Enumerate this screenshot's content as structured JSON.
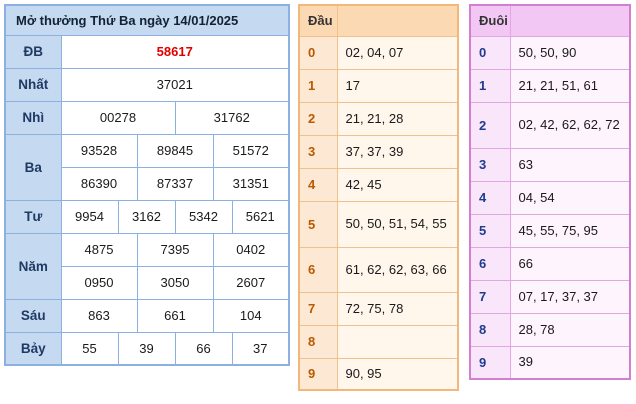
{
  "title": "Mở thưởng Thứ Ba ngày 14/01/2025",
  "results": {
    "db": {
      "label": "ĐB",
      "values": [
        "58617"
      ]
    },
    "nhat": {
      "label": "Nhất",
      "values": [
        "37021"
      ]
    },
    "nhi": {
      "label": "Nhì",
      "values": [
        "00278",
        "31762"
      ]
    },
    "ba": {
      "label": "Ba",
      "values": [
        "93528",
        "89845",
        "51572",
        "86390",
        "87337",
        "31351"
      ]
    },
    "tu": {
      "label": "Tư",
      "values": [
        "9954",
        "3162",
        "5342",
        "5621"
      ]
    },
    "nam": {
      "label": "Năm",
      "values": [
        "4875",
        "7395",
        "0402",
        "0950",
        "3050",
        "2607"
      ]
    },
    "sau": {
      "label": "Sáu",
      "values": [
        "863",
        "661",
        "104"
      ]
    },
    "bay": {
      "label": "Bảy",
      "values": [
        "55",
        "39",
        "66",
        "37"
      ]
    }
  },
  "dau": {
    "header": "Đầu",
    "rows": [
      {
        "key": "0",
        "value": "02, 04, 07"
      },
      {
        "key": "1",
        "value": "17"
      },
      {
        "key": "2",
        "value": "21, 21, 28"
      },
      {
        "key": "3",
        "value": "37, 37, 39"
      },
      {
        "key": "4",
        "value": "42, 45"
      },
      {
        "key": "5",
        "value": "50, 50, 51, 54, 55"
      },
      {
        "key": "6",
        "value": "61, 62, 62, 63, 66"
      },
      {
        "key": "7",
        "value": "72, 75, 78"
      },
      {
        "key": "8",
        "value": ""
      },
      {
        "key": "9",
        "value": "90, 95"
      }
    ]
  },
  "duoi": {
    "header": "Đuôi",
    "rows": [
      {
        "key": "0",
        "value": "50, 50, 90"
      },
      {
        "key": "1",
        "value": "21, 21, 51, 61"
      },
      {
        "key": "2",
        "value": "02, 42, 62, 62, 72"
      },
      {
        "key": "3",
        "value": "63"
      },
      {
        "key": "4",
        "value": "04, 54"
      },
      {
        "key": "5",
        "value": "45, 55, 75, 95"
      },
      {
        "key": "6",
        "value": "66"
      },
      {
        "key": "7",
        "value": "07, 17, 37, 37"
      },
      {
        "key": "8",
        "value": "28, 78"
      },
      {
        "key": "9",
        "value": "39"
      }
    ]
  }
}
